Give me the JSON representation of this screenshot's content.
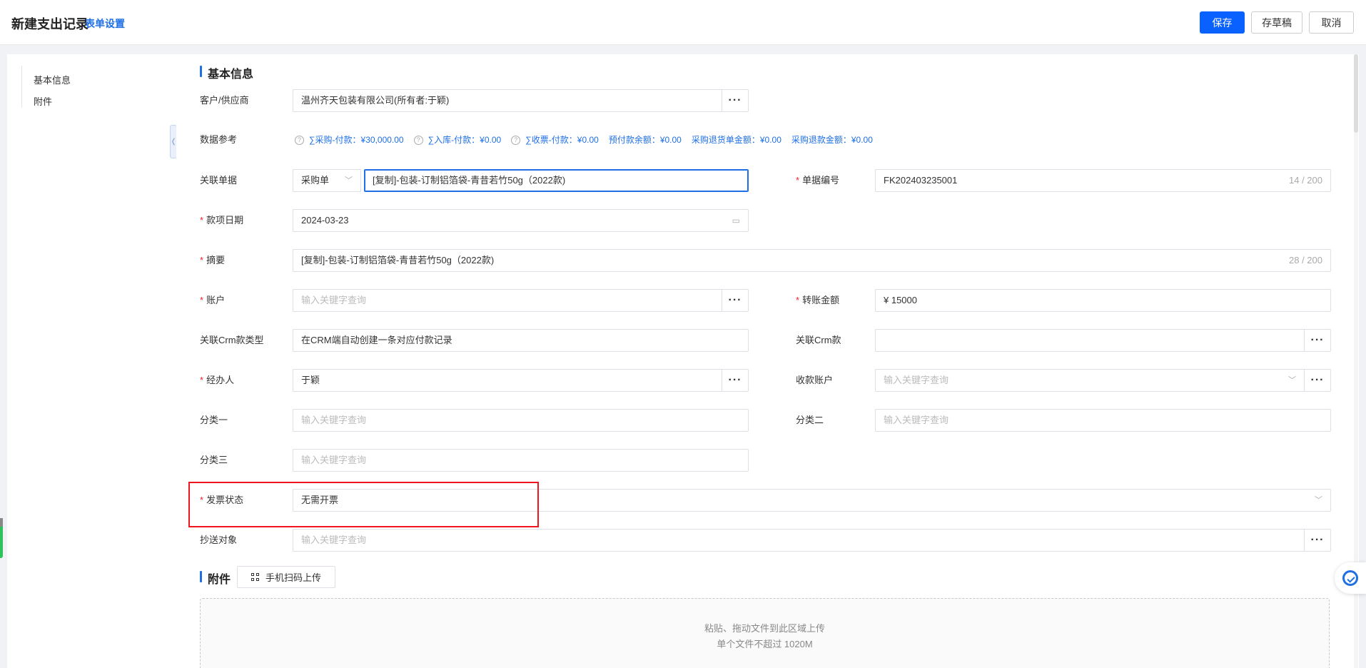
{
  "header": {
    "title": "新建支出记录",
    "form_settings": "表单设置",
    "save": "保存",
    "draft": "存草稿",
    "cancel": "取消"
  },
  "sidebar": {
    "items": [
      {
        "label": "基本信息"
      },
      {
        "label": "附件"
      }
    ]
  },
  "basic_section": {
    "title": "基本信息"
  },
  "fields": {
    "customer_supplier": {
      "label": "客户/供应商",
      "value": "温州齐天包装有限公司(所有者:于颖)"
    },
    "data_reference": {
      "label": "数据参考",
      "items": [
        {
          "text": "∑采购-付款：¥30,000.00",
          "help": true
        },
        {
          "text": "∑入库-付款：¥0.00",
          "help": true
        },
        {
          "text": "∑收票-付款：¥0.00",
          "help": true
        },
        {
          "text": "预付款余额：¥0.00",
          "help": false
        },
        {
          "text": "采购退货单金额：¥0.00",
          "help": false
        },
        {
          "text": "采购退款金额：¥0.00",
          "help": false
        }
      ]
    },
    "related_doc": {
      "label": "关联单据",
      "type": "采购单",
      "value": "[复制]-包装-订制铝箔袋-青昔若竹50g（2022款)"
    },
    "doc_number": {
      "label": "单据编号",
      "value": "FK202403235001",
      "counter": "14 / 200"
    },
    "payment_date": {
      "label": "款项日期",
      "value": "2024-03-23"
    },
    "summary": {
      "label": "摘要",
      "value": "[复制]-包装-订制铝箔袋-青昔若竹50g（2022款)",
      "counter": "28 / 200"
    },
    "account": {
      "label": "账户",
      "placeholder": "输入关键字查询"
    },
    "transfer_amount": {
      "label": "转账金额",
      "value": "¥  15000"
    },
    "crm_type": {
      "label": "关联Crm款类型",
      "value": "在CRM端自动创建一条对应付款记录"
    },
    "crm_payment": {
      "label": "关联Crm款",
      "value": ""
    },
    "handler": {
      "label": "经办人",
      "value": "于颖"
    },
    "receiving_account": {
      "label": "收款账户",
      "placeholder": "输入关键字查询"
    },
    "category1": {
      "label": "分类一",
      "placeholder": "输入关键字查询"
    },
    "category2": {
      "label": "分类二",
      "placeholder": "输入关键字查询"
    },
    "category3": {
      "label": "分类三",
      "placeholder": "输入关键字查询"
    },
    "invoice_status": {
      "label": "发票状态",
      "value": "无需开票"
    },
    "cc": {
      "label": "抄送对象",
      "placeholder": "输入关键字查询"
    }
  },
  "attachment_section": {
    "title": "附件",
    "scan_button": "手机扫码上传",
    "dropzone_line1": "粘贴、拖动文件到此区域上传",
    "dropzone_line2": "单个文件不超过 1020M"
  },
  "icons": {
    "more": "ellipsis-icon",
    "dropdown": "chevron-down-icon",
    "calendar": "calendar-icon",
    "help": "question-circle-icon",
    "qr": "qrcode-icon",
    "collapse": "chevron-left-icon",
    "assistant": "assistant-icon"
  },
  "colors": {
    "primary": "#0961ff",
    "link": "#1f6fe5",
    "required": "#f5222d",
    "highlight": "#f0141e"
  }
}
